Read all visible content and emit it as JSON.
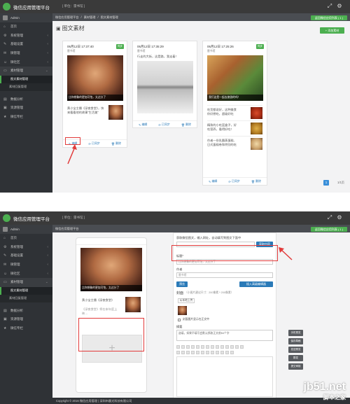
{
  "app": {
    "title": "微信应用管理平台",
    "subtitle": "[ 单位：雷书馆 ]"
  },
  "sidebar": {
    "user": "Admin",
    "items": [
      {
        "label": "首页",
        "icon": "home-icon"
      },
      {
        "label": "系统管理",
        "icon": "gear-icon"
      },
      {
        "label": "基础设置",
        "icon": "wrench-icon"
      },
      {
        "label": "微管理",
        "icon": "chat-icon"
      },
      {
        "label": "微社区",
        "icon": "people-icon"
      },
      {
        "label": "素材管理",
        "icon": "folder-icon"
      }
    ],
    "subitems": [
      "图文素材管理",
      "素材回复管理"
    ],
    "bottom_items": [
      {
        "label": "数据分析",
        "icon": "chart-icon"
      },
      {
        "label": "资源管理",
        "icon": "box-icon"
      },
      {
        "label": "微信专栏",
        "icon": "star-icon"
      }
    ]
  },
  "panel1": {
    "breadcrumb": [
      "微信应用管理平台",
      "素材管理",
      "图文素材管理"
    ],
    "top_button": "返回微信应用列表 ( 1 )",
    "section_title": "图文素材",
    "add_button": "+ 添加素材",
    "cards": [
      {
        "date": "06月12日 17:37:40",
        "source": "雷书馆",
        "tag": "同步",
        "caption": "比你想象的更加可怕，太过分了",
        "sub_text": "黄小宝主播《深夜食堂》，快来看看他的故事“生活美”",
        "actions": [
          "编辑",
          "已同步",
          "删除"
        ]
      },
      {
        "date": "06月12日 17:35:29",
        "source": "雷书馆",
        "text": "行走的大街，这是路，我走着！",
        "actions": [
          "编辑",
          "已同步",
          "删除"
        ]
      },
      {
        "date": "06月12日 17:25:26",
        "source": "雷书馆",
        "tag": "同步",
        "caption": "我们这是一起去旅游的吗！",
        "sub_items": [
          "吃货都说好，这种美食你好想吃，超级好吃",
          "精致的小吃篮盒子，好吃营养，看得好吃！",
          "作者一份乳酪蒸蛋糕、日式蛋糕卷和特别的吃"
        ],
        "actions": [
          "编辑",
          "已同步",
          "删除"
        ]
      }
    ],
    "pagination": [
      "1",
      "1/1页"
    ]
  },
  "panel2": {
    "breadcrumb": [
      "微信应用管理平台"
    ],
    "top_button": "返回微信应用列表 ( 1 )",
    "preview_caption": "比你想象的更加可怕，太过分了",
    "preview_sub": "黄小宝主播《深夜食堂》",
    "preview_sub2": "《深夜食堂》将在本年度上映…",
    "url_hint": "获取微信图文，输入网址，自动填写到图文下面中",
    "fetch_button": "获取内容",
    "title_label": "标题*",
    "title_value": "比你想象的更加可怕，太过分了",
    "author_label": "作者",
    "author_value": "雷书馆",
    "preview_button": "预览",
    "publish_button": "插入高级编辑器",
    "cover_label": "封面",
    "cover_hint": "（小图片建议尺寸：200像素 * 200像素）",
    "upload_button": "从本地上传",
    "checkbox_label": "封面图片显示在正文中",
    "summary_label": "摘要",
    "summary_text": "选填，如果不填写会默认抓取正文前54个字",
    "side_buttons": [
      "手机预览",
      "保存草稿",
      "发送预览",
      "群发",
      "提交审核"
    ],
    "footer": "Copyright © 2016 微信应用管理 | 深圳市晨光科技有限公司"
  },
  "watermark": {
    "main": "jb51.net",
    "sub": "脚本之家"
  }
}
